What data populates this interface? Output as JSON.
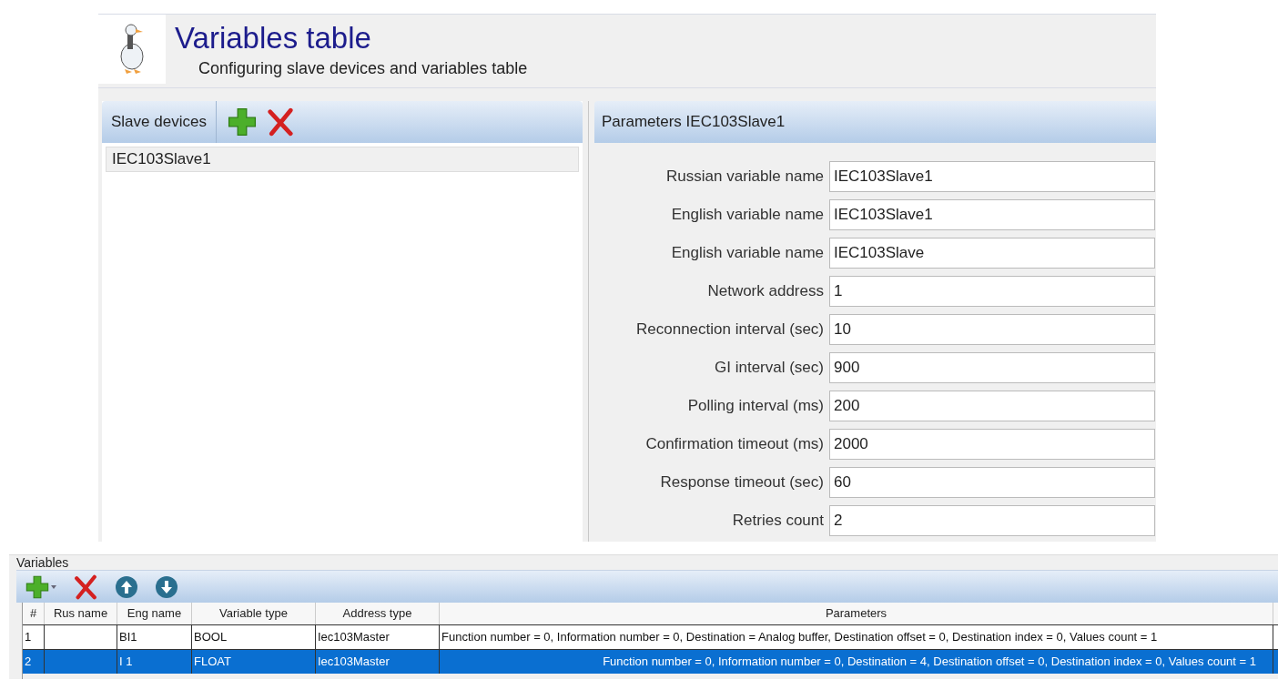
{
  "header": {
    "title": "Variables table",
    "subtitle": "Configuring slave devices and variables table"
  },
  "slave_devices": {
    "title": "Slave devices",
    "items": [
      {
        "label": "IEC103Slave1",
        "selected": true
      }
    ]
  },
  "parameters": {
    "title": "Parameters IEC103Slave1",
    "fields": [
      {
        "label": "Russian variable name",
        "value": "IEC103Slave1"
      },
      {
        "label": "English variable name",
        "value": "IEC103Slave1"
      },
      {
        "label": "English variable name",
        "value": "IEC103Slave"
      },
      {
        "label": "Network address",
        "value": "1"
      },
      {
        "label": "Reconnection interval (sec)",
        "value": "10"
      },
      {
        "label": "GI interval (sec)",
        "value": "900"
      },
      {
        "label": "Polling interval (ms)",
        "value": "200"
      },
      {
        "label": "Confirmation timeout (ms)",
        "value": "2000"
      },
      {
        "label": "Response timeout (sec)",
        "value": "60"
      },
      {
        "label": "Retries count",
        "value": "2"
      }
    ]
  },
  "variables": {
    "title": "Variables",
    "columns": [
      "#",
      "Rus name",
      "Eng name",
      "Variable type",
      "Address type",
      "Parameters"
    ],
    "rows": [
      {
        "selected": false,
        "cells": [
          "1",
          "",
          "BI1",
          "BOOL",
          "Iec103Master",
          "Function number = 0, Information number = 0, Destination = Analog buffer, Destination offset = 0, Destination index = 0, Values count = 1"
        ]
      },
      {
        "selected": true,
        "cells": [
          "2",
          "",
          "I 1",
          "FLOAT",
          "Iec103Master",
          "Function number = 0, Information number = 0, Destination = 4, Destination offset = 0, Destination index = 0, Values count = 1"
        ]
      }
    ]
  }
}
